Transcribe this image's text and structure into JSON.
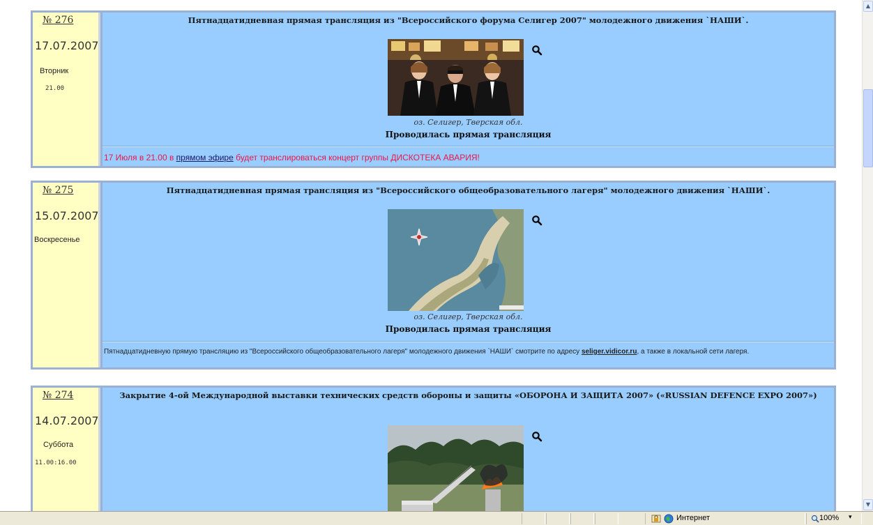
{
  "entries": [
    {
      "number": "№ 276",
      "date": "17.07.2007",
      "weekday": "Вторник",
      "time": "21.00",
      "title": "Пятнадцатидневная прямая трансляция из \"Всероссийского форума Селигер 2007\" молодежного движения `НАШИ`.",
      "caption": "оз. Селигер, Тверская обл.",
      "status": "Проводилась прямая трансляция",
      "note_before": "17 Июля в 21.00 в ",
      "note_link": "прямом эфире",
      "note_after": " будет транслироваться концерт группы ДИСКОТЕКА АВАРИЯ!"
    },
    {
      "number": "№ 275",
      "date": "15.07.2007",
      "weekday": "Воскресенье",
      "title": "Пятнадцатидневная прямая трансляция из \"Всероссийского общеобразовательного лагеря\" молодежного движения `НАШИ`.",
      "caption": "оз. Селигер, Тверская обл.",
      "status": "Проводилась прямая трансляция",
      "note_before": "Пятнадцатидневную прямую трансляцию из \"Всероссийского общеобразовательного лагеря\" молодежного движения `НАШИ` смотрите по адресу ",
      "note_link": "seliger.vidicor.ru",
      "note_after": ", а также в локальной сети лагеря."
    },
    {
      "number": "№ 274",
      "date": "14.07.2007",
      "weekday": "Суббота",
      "time": "11.00:16.00",
      "title": "Закрытие 4-ой Международной выставки технических средств обороны и защиты «ОБОРОНА И ЗАЩИТА 2007» («RUSSIAN DEFENCE EXPO 2007»)"
    }
  ],
  "statusbar": {
    "zone": "Интернет",
    "zoom": "100%"
  },
  "colors": {
    "left_column": "#ffffc4",
    "main_column": "#99ccff",
    "border": "#9bb1d3",
    "note_red": "#e8174a"
  },
  "icons": [
    "zoom-magnifier-icon",
    "security-lock-icon",
    "internet-globe-icon",
    "zoom-level-icon"
  ]
}
